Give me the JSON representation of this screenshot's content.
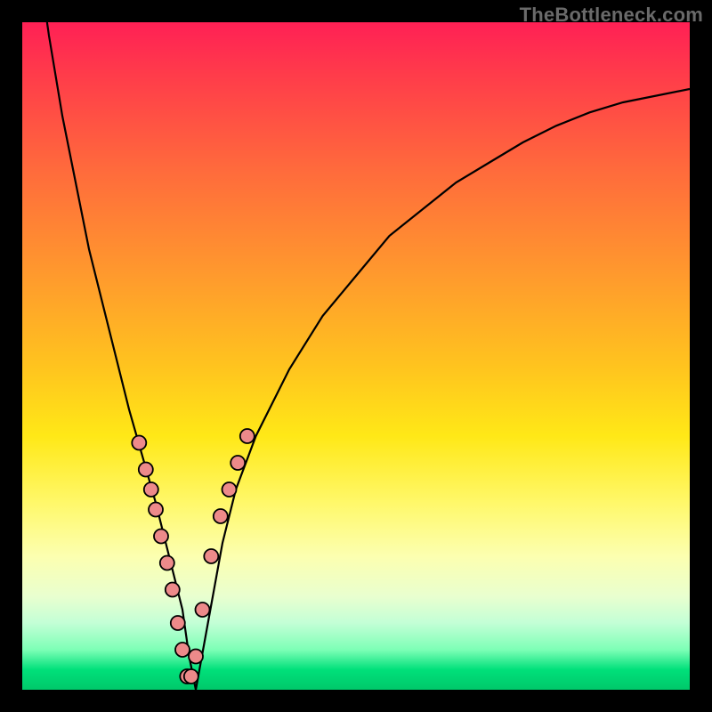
{
  "watermark": "TheBottleneck.com",
  "colors": {
    "frame": "#000000",
    "bead_fill": "#ed8a8a",
    "curve_stroke": "#000000"
  },
  "chart_data": {
    "type": "line",
    "title": "",
    "xlabel": "",
    "ylabel": "",
    "xlim": [
      0,
      100
    ],
    "ylim": [
      0,
      100
    ],
    "series": [
      {
        "name": "bottleneck-curve",
        "x": [
          0,
          2,
          4,
          6,
          8,
          10,
          12,
          14,
          16,
          18,
          20,
          22,
          24,
          25,
          26,
          28,
          30,
          32,
          35,
          40,
          45,
          50,
          55,
          60,
          65,
          70,
          75,
          80,
          85,
          90,
          95,
          100
        ],
        "values": [
          128,
          112,
          98,
          86,
          76,
          66,
          58,
          50,
          42,
          35,
          28,
          20,
          12,
          5,
          0,
          11,
          22,
          30,
          38,
          48,
          56,
          62,
          68,
          72,
          76,
          79,
          82,
          84.5,
          86.5,
          88,
          89,
          90
        ]
      }
    ],
    "markers": {
      "name": "highlighted-beads",
      "x": [
        17.5,
        18.5,
        19.3,
        20.0,
        20.8,
        21.7,
        22.5,
        23.3,
        24.0,
        24.7,
        25.3,
        26.0,
        27.0,
        28.3,
        29.7,
        31.0,
        32.3,
        33.7
      ],
      "values": [
        37,
        33,
        30,
        27,
        23,
        19,
        15,
        10,
        6,
        2,
        2,
        5,
        12,
        20,
        26,
        30,
        34,
        38
      ],
      "radius": 8
    }
  }
}
